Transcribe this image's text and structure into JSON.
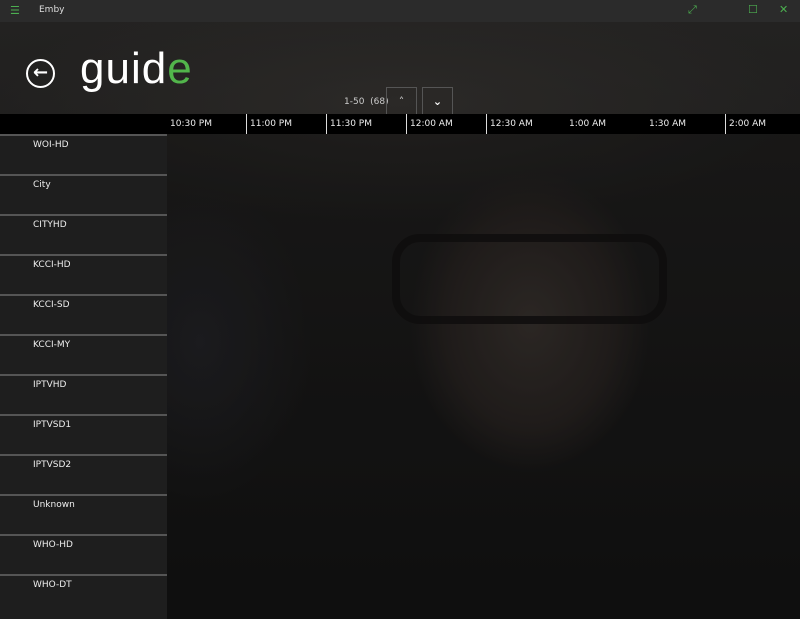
{
  "window": {
    "title": "Emby",
    "menu_icon": "hamburger-icon",
    "fullscreen_icon": "expand-icon",
    "maximize_icon": "square-icon",
    "close_icon": "close-icon"
  },
  "header": {
    "title_main": "guid",
    "title_accent": "e",
    "accent_color": "#52b54b",
    "back_icon": "back-arrow-icon"
  },
  "pager": {
    "range": "1-50",
    "total": "(68)",
    "up": "˄",
    "down": "⌄"
  },
  "timeline": [
    "10:30 PM",
    "11:00 PM",
    "11:30 PM",
    "12:00 AM",
    "12:30 AM",
    "1:00 AM",
    "1:30 AM",
    "2:00 AM"
  ],
  "channels": [
    "WOI-HD",
    "City",
    "CITYHD",
    "KCCI-HD",
    "KCCI-SD",
    "KCCI-MY",
    "IPTVHD",
    "IPTVSD1",
    "IPTVSD2",
    "Unknown",
    "WHO-HD",
    "WHO-DT"
  ]
}
